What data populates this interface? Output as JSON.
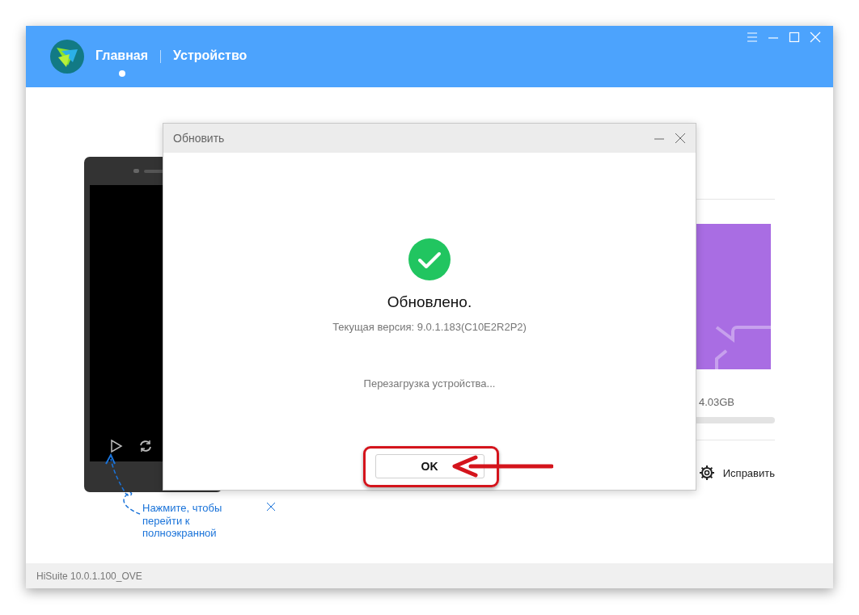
{
  "header": {
    "tabs": [
      {
        "label": "Главная",
        "selected": true
      },
      {
        "label": "Устройство",
        "selected": false
      }
    ]
  },
  "device_preview": {
    "tip": "Нажмите, чтобы перейти к полноэкранной"
  },
  "storage": {
    "reading": "4.03GB"
  },
  "fix_button": "Исправить",
  "dialog": {
    "title": "Обновить",
    "heading": "Обновлено.",
    "version": "Текущая версия: 9.0.1.183(C10E2R2P2)",
    "status": "Перезагрузка устройства...",
    "ok_button": "OK"
  },
  "status_bar": {
    "version": "HiSuite 10.0.1.100_OVE"
  }
}
